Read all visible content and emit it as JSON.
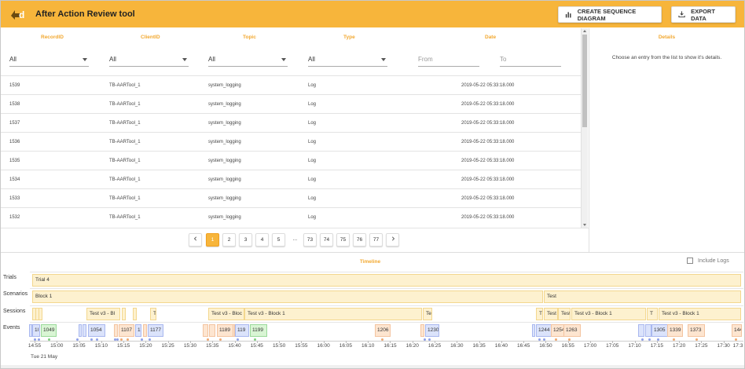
{
  "app": {
    "title": "After Action Review tool"
  },
  "toolbar": {
    "sequence_label": "CREATE SEQUENCE DIAGRAM",
    "export_label": "EXPORT DATA",
    "sequence_icon": "bar-chart-icon",
    "export_icon": "download-icon"
  },
  "table": {
    "headers": [
      "RecordID",
      "ClientID",
      "Topic",
      "Type",
      "Date"
    ],
    "filters": {
      "record": "All",
      "client": "All",
      "topic": "All",
      "type": "All",
      "from_placeholder": "From",
      "to_placeholder": "To"
    },
    "rows": [
      {
        "id": "1539",
        "client": "TB-AARTool_1",
        "topic": "system_logging",
        "type": "Log",
        "date": "2019-05-22 05:33:18.000"
      },
      {
        "id": "1538",
        "client": "TB-AARTool_1",
        "topic": "system_logging",
        "type": "Log",
        "date": "2019-05-22 05:33:18.000"
      },
      {
        "id": "1537",
        "client": "TB-AARTool_1",
        "topic": "system_logging",
        "type": "Log",
        "date": "2019-05-22 05:33:18.000"
      },
      {
        "id": "1536",
        "client": "TB-AARTool_1",
        "topic": "system_logging",
        "type": "Log",
        "date": "2019-05-22 05:33:18.000"
      },
      {
        "id": "1535",
        "client": "TB-AARTool_1",
        "topic": "system_logging",
        "type": "Log",
        "date": "2019-05-22 05:33:18.000"
      },
      {
        "id": "1534",
        "client": "TB-AARTool_1",
        "topic": "system_logging",
        "type": "Log",
        "date": "2019-05-22 05:33:18.000"
      },
      {
        "id": "1533",
        "client": "TB-AARTool_1",
        "topic": "system_logging",
        "type": "Log",
        "date": "2019-05-22 05:33:18.000"
      },
      {
        "id": "1532",
        "client": "TB-AARTool_1",
        "topic": "system_logging",
        "type": "Log",
        "date": "2019-05-22 05:33:18.000"
      }
    ]
  },
  "pagination": {
    "pages": [
      "1",
      "2",
      "3",
      "4",
      "5",
      "...",
      "73",
      "74",
      "75",
      "76",
      "77"
    ],
    "active": "1"
  },
  "details": {
    "title": "Details",
    "message": "Choose an entry from the list to show it's details."
  },
  "timeline": {
    "title": "Timeline",
    "include_logs": "Include Logs",
    "lanes": [
      "Trials",
      "Scenarios",
      "Sessions",
      "Events"
    ],
    "trial": "Trial 4",
    "scenarios": [
      "Block 1",
      "Test"
    ],
    "sessions": [
      "Test v3 - Bl",
      "T",
      "Test v3 - Bloc",
      "Test v3 - Block 1",
      "Te:",
      "Tr",
      "Test",
      "Test",
      "Test v3 - Block 1",
      "T",
      "Test v3 - Block 1"
    ],
    "events": [
      "1l",
      "1049",
      "1054",
      "1107",
      "1'",
      "1177",
      "1189",
      "119",
      "1199",
      "1206",
      "1230",
      "1244",
      "1254",
      "1263",
      "1305",
      "1339",
      "1373",
      "144"
    ],
    "ticks": [
      "14:55",
      "15:00",
      "15:05",
      "15:10",
      "15:15",
      "15:20",
      "15:25",
      "15:30",
      "15:35",
      "15:40",
      "15:45",
      "15:50",
      "15:55",
      "16:00",
      "16:05",
      "16:10",
      "16:15",
      "16:20",
      "16:25",
      "16:30",
      "16:35",
      "16:40",
      "16:45",
      "16:50",
      "16:55",
      "17:00",
      "17:05",
      "17:10",
      "17:15",
      "17:20",
      "17:25",
      "17:30",
      "17:3"
    ],
    "date": "Tue 21 May"
  },
  "colors": {
    "accent": "#f7b53b",
    "header_text": "#f2a830"
  }
}
